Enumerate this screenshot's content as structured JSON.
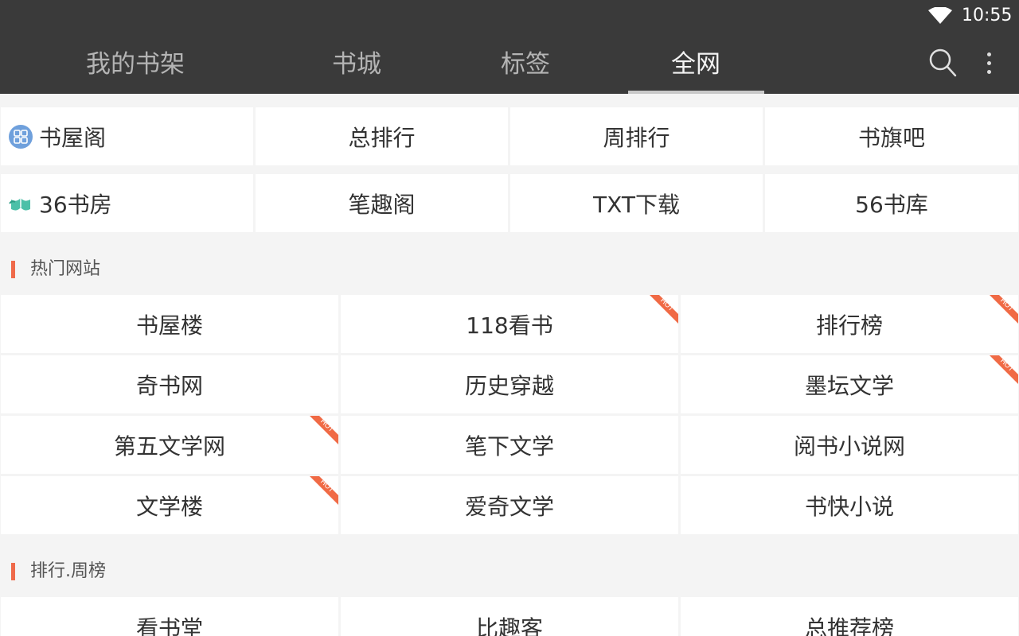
{
  "status": {
    "time": "10:55"
  },
  "tabs": [
    {
      "label": "我的书架",
      "active": false
    },
    {
      "label": "书城",
      "active": false
    },
    {
      "label": "标签",
      "active": false
    },
    {
      "label": "全网",
      "active": true
    }
  ],
  "top_grid": {
    "row1": [
      "书屋阁",
      "总排行",
      "周排行",
      "书旗吧"
    ],
    "row2": [
      "36书房",
      "笔趣阁",
      "TXT下载",
      "56书库"
    ]
  },
  "hot_sites": {
    "title": "热门网站",
    "items": [
      {
        "label": "书屋楼",
        "hot": false
      },
      {
        "label": "118看书",
        "hot": true
      },
      {
        "label": "排行榜",
        "hot": true
      },
      {
        "label": "奇书网",
        "hot": false
      },
      {
        "label": "历史穿越",
        "hot": false
      },
      {
        "label": "墨坛文学",
        "hot": true
      },
      {
        "label": "第五文学网",
        "hot": true
      },
      {
        "label": "笔下文学",
        "hot": false
      },
      {
        "label": "阅书小说网",
        "hot": false
      },
      {
        "label": "文学楼",
        "hot": true
      },
      {
        "label": "爱奇文学",
        "hot": false
      },
      {
        "label": "书快小说",
        "hot": false
      }
    ]
  },
  "weekly_rank": {
    "title": "排行.周榜",
    "items": [
      "看书堂",
      "比趣客",
      "总推荐榜"
    ]
  },
  "badge_text": "HOT",
  "colors": {
    "header": "#3a3a3a",
    "accent": "#ef6a4a",
    "hot_badge": "#f06a45"
  }
}
